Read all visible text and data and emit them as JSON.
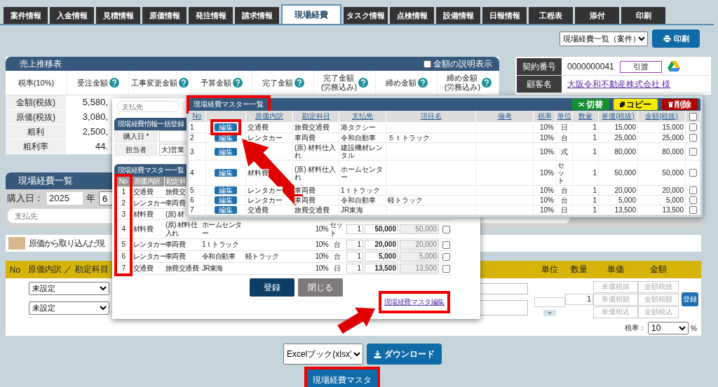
{
  "tabs": [
    {
      "label": "案件情報",
      "selected": false
    },
    {
      "label": "入金情報",
      "selected": false
    },
    {
      "label": "見積情報",
      "selected": false
    },
    {
      "label": "原価情報",
      "selected": false
    },
    {
      "label": "発注情報",
      "selected": false
    },
    {
      "label": "請求情報",
      "selected": false
    },
    {
      "label": "現場経費",
      "selected": true
    },
    {
      "label": "タスク情報",
      "selected": false
    },
    {
      "label": "点検情報",
      "selected": false
    },
    {
      "label": "設備情報",
      "selected": false
    },
    {
      "label": "日報情報",
      "selected": false
    },
    {
      "label": "工程表",
      "selected": false
    },
    {
      "label": "添付",
      "selected": false
    },
    {
      "label": "印刷",
      "selected": false
    }
  ],
  "view_select": "現場経費一覧（案件）",
  "print_button": "印刷",
  "sales_panel": {
    "title": "売上推移表",
    "explain_checkbox": {
      "label": "金額の説明表示",
      "checked": false
    },
    "columns": [
      {
        "lines": [
          "税率(10%)"
        ],
        "help": false
      },
      {
        "lines": [
          "受注金額"
        ],
        "help": true
      },
      {
        "lines": [
          "工事変更金額"
        ],
        "help": true
      },
      {
        "lines": [
          "予算金額"
        ],
        "help": true
      },
      {
        "lines": [
          "完了金額"
        ],
        "help": true
      },
      {
        "lines": [
          "完了金額",
          "(労務込み)"
        ],
        "help": true
      },
      {
        "lines": [
          "締め金額"
        ],
        "help": true
      },
      {
        "lines": [
          "締め金額",
          "(労務込み)"
        ],
        "help": true
      }
    ],
    "rows": [
      {
        "label": "金額(税抜)",
        "value": "5,580,"
      },
      {
        "label": "原価(税抜)",
        "value": "3,080,"
      },
      {
        "label": "粗利",
        "value": "2,500,"
      },
      {
        "label": "粗利率",
        "value": "44."
      }
    ]
  },
  "contract": [
    {
      "kind": "number",
      "label": "契約番号",
      "value": "0000000041",
      "badge": "引渡"
    },
    {
      "kind": "link",
      "label": "顧客名",
      "value": "大阪令和不動産株式会社 様"
    }
  ],
  "expense_list": {
    "title": "現場経費一覧",
    "date_label": "購入日：",
    "year": "2025",
    "year_unit": "年",
    "month": "6",
    "payee_placeholder": "支払先",
    "legend": "原価から取り込んだ現",
    "left_columns": [
      "No",
      "原価内訳 ／ 勘定科目"
    ],
    "right_columns": [
      "単位",
      "数量",
      "単価",
      "金額"
    ],
    "entry": {
      "selects": [
        "未設定",
        "未設定"
      ],
      "quantity": "1",
      "price_buttons": [
        "単価税抜",
        "単価税額",
        "単価税込"
      ],
      "amount_buttons": [
        "金額税抜",
        "金額税額",
        "金額税込"
      ],
      "register_button": "登録"
    },
    "tax_label": "税率：",
    "tax_value": "10",
    "tax_unit": "%"
  },
  "export": {
    "format": "Excelブック(xlsx)",
    "download_button": "ダウンロード",
    "master_button": "現場経費マスタ"
  },
  "bulk_dialog": {
    "payee_placeholder": "支払先",
    "section_title": "現場経費情報一括登録",
    "date_label": "購入日 *",
    "staff_label": "担当者",
    "staff_value": "大)営業",
    "master_title": "現場経費マスター一覧",
    "columns": [
      "No",
      "原価内訳",
      "勘定科"
    ],
    "rows": [
      {
        "no": "1",
        "breakdown": "交通費",
        "account": "旅費交"
      },
      {
        "no": "2",
        "breakdown": "レンタカー",
        "account": "車両費"
      },
      {
        "no": "3",
        "breakdown": "材料費",
        "account": "(原) 材"
      },
      {
        "no": "4",
        "breakdown": "材料費",
        "account": "(原) 材料仕入れ",
        "payee": "ホームセンター",
        "rate": "10%",
        "unit": "セット",
        "qty": "1",
        "price": "50,000",
        "amount": "50,000",
        "checked": false
      },
      {
        "no": "5",
        "breakdown": "レンタカー",
        "account": "車両費",
        "payee": "1ｔトラック",
        "rate": "10%",
        "unit": "台",
        "qty": "1",
        "price": "20,000",
        "amount": "20,000",
        "checked": false
      },
      {
        "no": "6",
        "breakdown": "レンタカー",
        "account": "車両費",
        "payee": "令和自動車",
        "item": "軽トラック",
        "rate": "10%",
        "unit": "台",
        "qty": "1",
        "price": "5,000",
        "amount": "5,000",
        "checked": false
      },
      {
        "no": "7",
        "breakdown": "交通費",
        "account": "旅費交通費",
        "payee": "JR東海",
        "rate": "10%",
        "unit": "日",
        "qty": "1",
        "price": "13,500",
        "amount": "13,500",
        "checked": false
      }
    ],
    "register_button": "登録",
    "close_button": "閉じる",
    "edit_link": "現場経費マスタ編集"
  },
  "master_dialog": {
    "title": "現場経費マスター一覧",
    "buttons": [
      {
        "kind": "switch",
        "label": "切替"
      },
      {
        "kind": "copy",
        "label": "コピー"
      },
      {
        "kind": "delete",
        "label": "削除"
      }
    ],
    "columns": [
      "No",
      "原価内訳",
      "勘定科目",
      "支払先",
      "項目名",
      "備考",
      "税率",
      "単位",
      "数量",
      "単価(税抜)",
      "金額(税抜)"
    ],
    "all_checked": false,
    "rows": [
      {
        "no": "1",
        "edit": "編集",
        "breakdown": "交通費",
        "account": "旅費交通費",
        "payee": "港タクシー",
        "rate": "10%",
        "unit": "日",
        "qty": "1",
        "price": "15,000",
        "amount": "15,000",
        "checked": false
      },
      {
        "no": "2",
        "edit": "編集",
        "breakdown": "レンタカー",
        "account": "車両費",
        "payee": "令和自動車",
        "item": "５ｔトラック",
        "rate": "10%",
        "unit": "台",
        "qty": "1",
        "price": "25,000",
        "amount": "25,000",
        "checked": false
      },
      {
        "no": "3",
        "edit": "編集",
        "account": "(原) 材料仕入れ",
        "payee": "建設機材レンタル",
        "rate": "10%",
        "unit": "式",
        "qty": "1",
        "price": "80,000",
        "amount": "80,000",
        "checked": false
      },
      {
        "no": "4",
        "edit": "編集",
        "breakdown": "材料費",
        "account": "(原) 材料仕入れ",
        "payee": "ホームセンター",
        "rate": "10%",
        "unit": "セット",
        "qty": "1",
        "price": "50,000",
        "amount": "50,000",
        "checked": false
      },
      {
        "no": "5",
        "edit": "編集",
        "breakdown": "レンタカー",
        "account": "車両費",
        "payee": "1ｔトラック",
        "rate": "10%",
        "unit": "台",
        "qty": "1",
        "price": "20,000",
        "amount": "20,000",
        "checked": false
      },
      {
        "no": "6",
        "edit": "編集",
        "breakdown": "レンタカー",
        "account": "車両費",
        "payee": "令和自動車",
        "item": "軽トラック",
        "rate": "10%",
        "unit": "台",
        "qty": "1",
        "price": "5,000",
        "amount": "5,000",
        "checked": false
      },
      {
        "no": "7",
        "edit": "編集",
        "breakdown": "交通費",
        "account": "旅費交通費",
        "payee": "JR東海",
        "rate": "10%",
        "unit": "日",
        "qty": "1",
        "price": "13,500",
        "amount": "13,500",
        "checked": false
      }
    ]
  }
}
